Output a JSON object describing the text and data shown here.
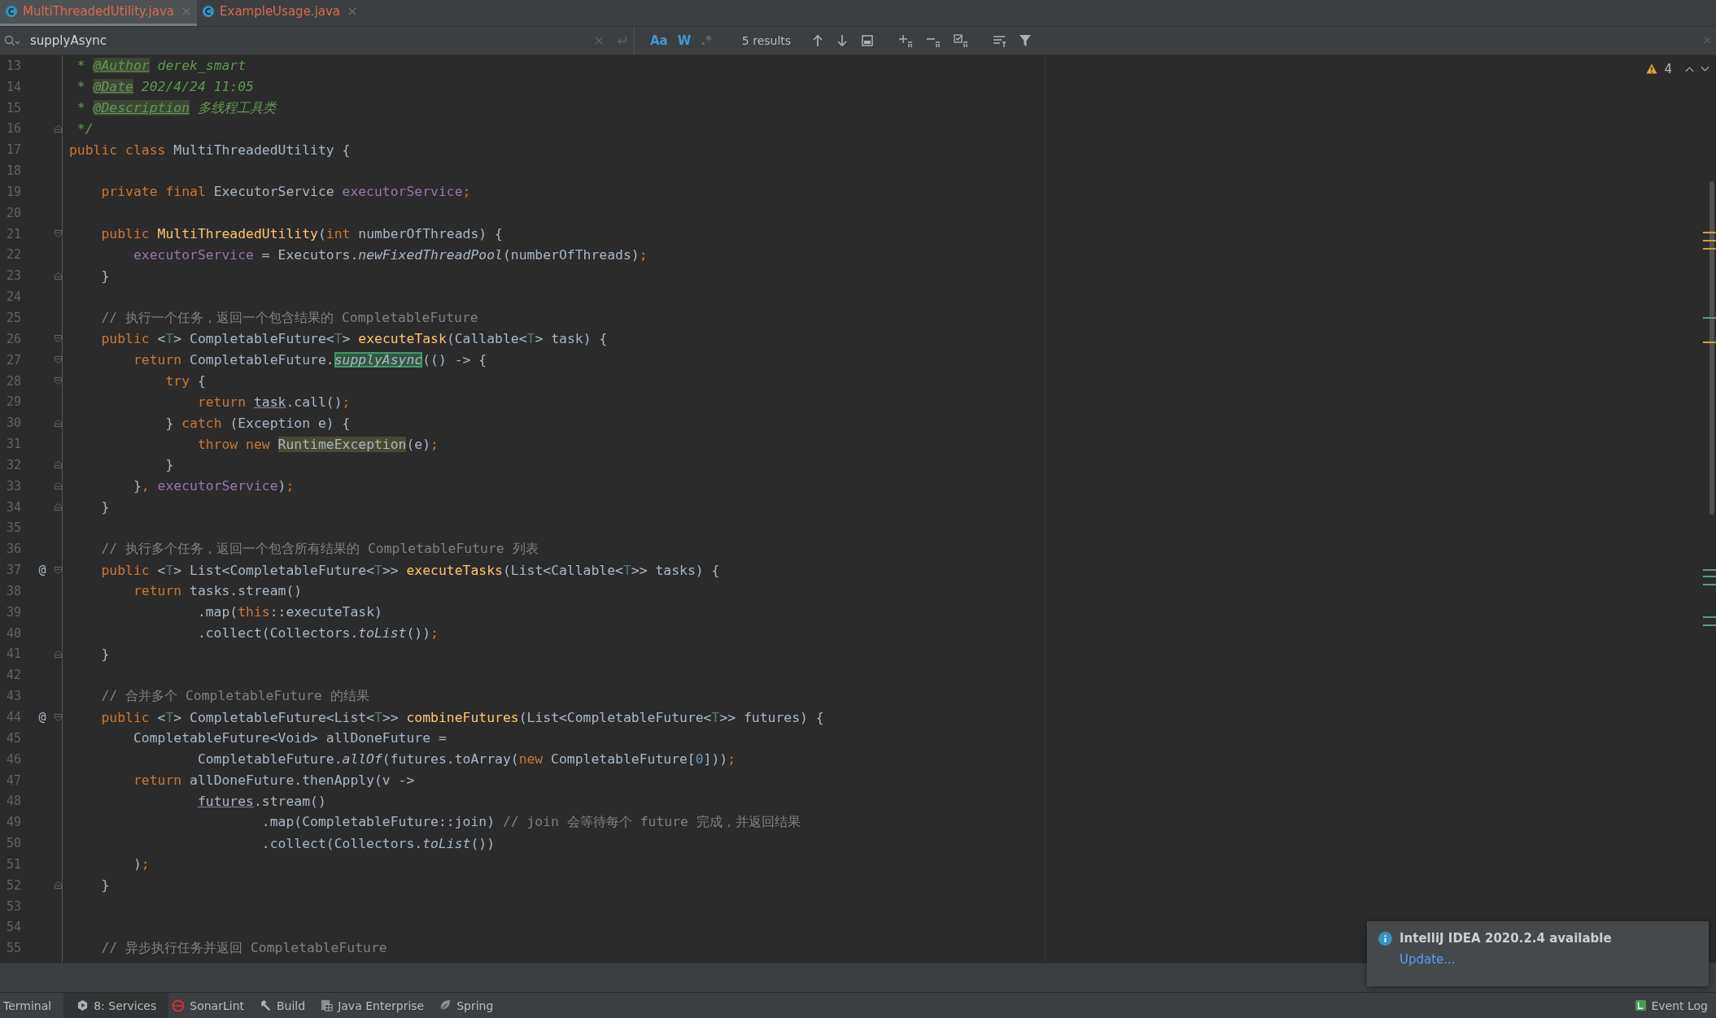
{
  "tabs": [
    {
      "label": "MultiThreadedUtility.java",
      "selected": true
    },
    {
      "label": "ExampleUsage.java",
      "selected": false
    }
  ],
  "search": {
    "value": "supplyAsync",
    "options": [
      {
        "label": "Aa",
        "selected": true
      },
      {
        "label": "W",
        "selected": true
      },
      {
        "label": ".*",
        "selected": false
      }
    ],
    "results": "5 results",
    "actions": [
      {
        "kind": "up"
      },
      {
        "kind": "down"
      },
      {
        "kind": "select-all"
      },
      {
        "kind": "add"
      },
      {
        "kind": "remove"
      },
      {
        "kind": "toggle"
      },
      {
        "kind": "options"
      },
      {
        "kind": "filter"
      }
    ]
  },
  "inspections": {
    "warnings": "4"
  },
  "lines": [
    {
      "number": "13",
      "tokens": [
        {
          "text": " * ",
          "kind": "doc"
        },
        {
          "text": "@Author",
          "kind": "doctag"
        },
        {
          "text": " derek_smart",
          "kind": "doc"
        }
      ]
    },
    {
      "number": "14",
      "tokens": [
        {
          "text": " * ",
          "kind": "doc"
        },
        {
          "text": "@Date",
          "kind": "doctag"
        },
        {
          "text": " 202/4/24 11:05",
          "kind": "doc"
        }
      ]
    },
    {
      "number": "15",
      "tokens": [
        {
          "text": " * ",
          "kind": "doc"
        },
        {
          "text": "@Description",
          "kind": "doctag"
        },
        {
          "text": " 多线程工具类",
          "kind": "doc"
        }
      ]
    },
    {
      "number": "16",
      "fold_open": false,
      "tokens": [
        {
          "text": " */",
          "kind": "doc"
        }
      ]
    },
    {
      "number": "17",
      "tokens": [
        {
          "text": "public class ",
          "kind": "kw"
        },
        {
          "text": "MultiThreadedUtility {",
          "kind": "plain"
        }
      ]
    },
    {
      "number": "18"
    },
    {
      "number": "19",
      "tokens": [
        {
          "text": "    private final ",
          "kind": "kw"
        },
        {
          "text": "ExecutorService ",
          "kind": "plain"
        },
        {
          "text": "executorService",
          "kind": "field"
        },
        {
          "text": ";",
          "kind": "kw"
        }
      ]
    },
    {
      "number": "20"
    },
    {
      "number": "21",
      "fold_open": true,
      "tokens": [
        {
          "text": "    public ",
          "kind": "kw"
        },
        {
          "text": "MultiThreadedUtility",
          "kind": "method"
        },
        {
          "text": "(",
          "kind": "plain"
        },
        {
          "text": "int ",
          "kind": "kw"
        },
        {
          "text": "numberOfThreads) {",
          "kind": "plain"
        }
      ]
    },
    {
      "number": "22",
      "tokens": [
        {
          "text": "        executorService",
          "kind": "field"
        },
        {
          "text": " = Executors.",
          "kind": "plain"
        },
        {
          "text": "newFixedThreadPool",
          "kind": "static"
        },
        {
          "text": "(numberOfThreads)",
          "kind": "plain"
        },
        {
          "text": ";",
          "kind": "kw"
        }
      ]
    },
    {
      "number": "23",
      "fold_open": false,
      "tokens": [
        {
          "text": "    }",
          "kind": "plain"
        }
      ]
    },
    {
      "number": "24"
    },
    {
      "number": "25",
      "tokens": [
        {
          "text": "    // 执行一个任务，返回一个包含结果的 CompletableFuture",
          "kind": "comment"
        }
      ]
    },
    {
      "number": "26",
      "fold_open": true,
      "tokens": [
        {
          "text": "    public ",
          "kind": "kw"
        },
        {
          "text": "<",
          "kind": "plain"
        },
        {
          "text": "T",
          "kind": "tparam"
        },
        {
          "text": "> CompletableFuture<",
          "kind": "plain"
        },
        {
          "text": "T",
          "kind": "tparam"
        },
        {
          "text": "> ",
          "kind": "plain"
        },
        {
          "text": "executeTask",
          "kind": "method"
        },
        {
          "text": "(Callable<",
          "kind": "plain"
        },
        {
          "text": "T",
          "kind": "tparam"
        },
        {
          "text": "> task) {",
          "kind": "plain"
        }
      ]
    },
    {
      "number": "27",
      "fold_open": true,
      "tokens": [
        {
          "text": "        return ",
          "kind": "kw"
        },
        {
          "text": "CompletableFuture.",
          "kind": "plain"
        },
        {
          "text": "supplyAsync",
          "kind": "hit"
        },
        {
          "text": "(() -> {",
          "kind": "plain"
        }
      ]
    },
    {
      "number": "28",
      "fold_open": true,
      "tokens": [
        {
          "text": "            try ",
          "kind": "kw"
        },
        {
          "text": "{",
          "kind": "plain"
        }
      ]
    },
    {
      "number": "29",
      "tokens": [
        {
          "text": "                return ",
          "kind": "kw"
        },
        {
          "text": "task",
          "kind": "ul"
        },
        {
          "text": ".call()",
          "kind": "plain"
        },
        {
          "text": ";",
          "kind": "kw"
        }
      ]
    },
    {
      "number": "30",
      "fold_open": false,
      "tokens": [
        {
          "text": "            } ",
          "kind": "plain"
        },
        {
          "text": "catch ",
          "kind": "kw"
        },
        {
          "text": "(Exception e) {",
          "kind": "plain"
        }
      ]
    },
    {
      "number": "31",
      "tokens": [
        {
          "text": "                throw new ",
          "kind": "kw"
        },
        {
          "text": "RuntimeException",
          "kind": "hl"
        },
        {
          "text": "(e)",
          "kind": "plain"
        },
        {
          "text": ";",
          "kind": "kw"
        }
      ]
    },
    {
      "number": "32",
      "fold_open": false,
      "tokens": [
        {
          "text": "            }",
          "kind": "plain"
        }
      ]
    },
    {
      "number": "33",
      "fold_open": false,
      "tokens": [
        {
          "text": "        }",
          "kind": "plain"
        },
        {
          "text": ", ",
          "kind": "kw"
        },
        {
          "text": "executorService",
          "kind": "field"
        },
        {
          "text": ")",
          "kind": "plain"
        },
        {
          "text": ";",
          "kind": "kw"
        }
      ]
    },
    {
      "number": "34",
      "fold_open": false,
      "tokens": [
        {
          "text": "    }",
          "kind": "plain"
        }
      ]
    },
    {
      "number": "35"
    },
    {
      "number": "36",
      "tokens": [
        {
          "text": "    // 执行多个任务，返回一个包含所有结果的 CompletableFuture 列表",
          "kind": "comment"
        }
      ]
    },
    {
      "number": "37",
      "marker": "@",
      "fold_open": true,
      "tokens": [
        {
          "text": "    public ",
          "kind": "kw"
        },
        {
          "text": "<",
          "kind": "plain"
        },
        {
          "text": "T",
          "kind": "tparam"
        },
        {
          "text": "> List<CompletableFuture<",
          "kind": "plain"
        },
        {
          "text": "T",
          "kind": "tparam"
        },
        {
          "text": ">> ",
          "kind": "plain"
        },
        {
          "text": "executeTasks",
          "kind": "method"
        },
        {
          "text": "(List<Callable<",
          "kind": "plain"
        },
        {
          "text": "T",
          "kind": "tparam"
        },
        {
          "text": ">> tasks) {",
          "kind": "plain"
        }
      ]
    },
    {
      "number": "38",
      "tokens": [
        {
          "text": "        return ",
          "kind": "kw"
        },
        {
          "text": "tasks.stream()",
          "kind": "plain"
        }
      ]
    },
    {
      "number": "39",
      "tokens": [
        {
          "text": "                .map(",
          "kind": "plain"
        },
        {
          "text": "this",
          "kind": "kw"
        },
        {
          "text": "::executeTask)",
          "kind": "plain"
        }
      ]
    },
    {
      "number": "40",
      "tokens": [
        {
          "text": "                .collect(Collectors.",
          "kind": "plain"
        },
        {
          "text": "toList",
          "kind": "static"
        },
        {
          "text": "())",
          "kind": "plain"
        },
        {
          "text": ";",
          "kind": "kw"
        }
      ]
    },
    {
      "number": "41",
      "fold_open": false,
      "tokens": [
        {
          "text": "    }",
          "kind": "plain"
        }
      ]
    },
    {
      "number": "42"
    },
    {
      "number": "43",
      "tokens": [
        {
          "text": "    // 合并多个 CompletableFuture 的结果",
          "kind": "comment"
        }
      ]
    },
    {
      "number": "44",
      "marker": "@",
      "fold_open": true,
      "tokens": [
        {
          "text": "    public ",
          "kind": "kw"
        },
        {
          "text": "<",
          "kind": "plain"
        },
        {
          "text": "T",
          "kind": "tparam"
        },
        {
          "text": "> CompletableFuture<List<",
          "kind": "plain"
        },
        {
          "text": "T",
          "kind": "tparam"
        },
        {
          "text": ">> ",
          "kind": "plain"
        },
        {
          "text": "combineFutures",
          "kind": "method"
        },
        {
          "text": "(List<CompletableFuture<",
          "kind": "plain"
        },
        {
          "text": "T",
          "kind": "tparam"
        },
        {
          "text": ">> futures) {",
          "kind": "plain"
        }
      ]
    },
    {
      "number": "45",
      "tokens": [
        {
          "text": "        CompletableFuture<Void> allDoneFuture =",
          "kind": "plain"
        }
      ]
    },
    {
      "number": "46",
      "tokens": [
        {
          "text": "                CompletableFuture.",
          "kind": "plain"
        },
        {
          "text": "allOf",
          "kind": "static"
        },
        {
          "text": "(futures.toArray(",
          "kind": "plain"
        },
        {
          "text": "new ",
          "kind": "kw"
        },
        {
          "text": "CompletableFuture[",
          "kind": "plain"
        },
        {
          "text": "0",
          "kind": "num"
        },
        {
          "text": "]))",
          "kind": "plain"
        },
        {
          "text": ";",
          "kind": "kw"
        }
      ]
    },
    {
      "number": "47",
      "tokens": [
        {
          "text": "        return ",
          "kind": "kw"
        },
        {
          "text": "allDoneFuture.thenApply(v ->",
          "kind": "plain"
        }
      ]
    },
    {
      "number": "48",
      "tokens": [
        {
          "text": "                futures",
          "kind": "ul"
        },
        {
          "text": ".stream()",
          "kind": "plain"
        }
      ]
    },
    {
      "number": "49",
      "tokens": [
        {
          "text": "                        .map(CompletableFuture::join) ",
          "kind": "plain"
        },
        {
          "text": "// join 会等待每个 future 完成，并返回结果",
          "kind": "comment"
        }
      ]
    },
    {
      "number": "50",
      "tokens": [
        {
          "text": "                        .collect(Collectors.",
          "kind": "plain"
        },
        {
          "text": "toList",
          "kind": "static"
        },
        {
          "text": "())",
          "kind": "plain"
        }
      ]
    },
    {
      "number": "51",
      "tokens": [
        {
          "text": "        )",
          "kind": "plain"
        },
        {
          "text": ";",
          "kind": "kw"
        }
      ]
    },
    {
      "number": "52",
      "fold_open": false,
      "tokens": [
        {
          "text": "    }",
          "kind": "plain"
        }
      ]
    },
    {
      "number": "53"
    },
    {
      "number": "54"
    },
    {
      "number": "55",
      "tokens": [
        {
          "text": "    // 异步执行任务并返回 CompletableFuture",
          "kind": "comment"
        }
      ]
    }
  ],
  "notification": {
    "title": "IntelliJ IDEA 2020.2.4 available",
    "link": "Update..."
  },
  "tool_windows": [
    {
      "label": "Terminal",
      "kind": "plain",
      "selected": false
    },
    {
      "label": "8: Services",
      "kind": "services",
      "selected": true
    },
    {
      "label": "SonarLint",
      "kind": "sonar",
      "selected": false
    },
    {
      "label": "Build",
      "kind": "build",
      "selected": false
    },
    {
      "label": "Java Enterprise",
      "kind": "enterprise",
      "selected": false
    },
    {
      "label": "Spring",
      "kind": "spring",
      "selected": false
    }
  ],
  "event_log": {
    "label": "Event Log"
  }
}
